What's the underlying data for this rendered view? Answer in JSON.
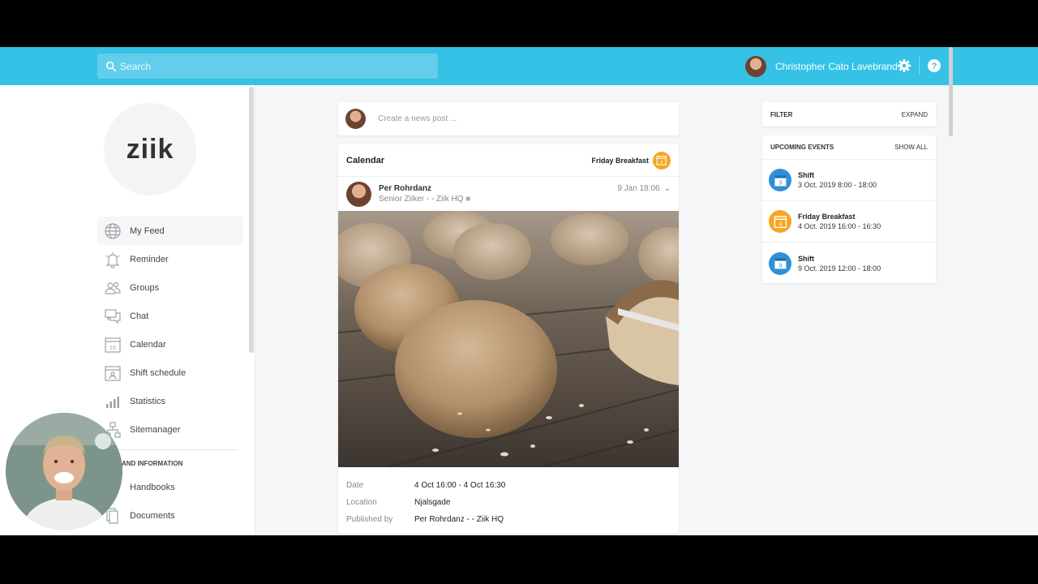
{
  "search": {
    "placeholder": "Search"
  },
  "user": {
    "name": "Christopher Cato Lavebrand"
  },
  "logo": {
    "text": "ziik"
  },
  "sidebar": {
    "items": [
      {
        "label": "My Feed",
        "icon": "globe-icon"
      },
      {
        "label": "Reminder",
        "icon": "bell-icon"
      },
      {
        "label": "Groups",
        "icon": "users-icon"
      },
      {
        "label": "Chat",
        "icon": "chat-icon"
      },
      {
        "label": "Calendar",
        "icon": "calendar-icon"
      },
      {
        "label": "Shift schedule",
        "icon": "shift-icon"
      },
      {
        "label": "Statistics",
        "icon": "bar-chart-icon"
      },
      {
        "label": "Sitemanager",
        "icon": "sitemap-icon"
      }
    ],
    "section_title": "AND INFORMATION",
    "info_items": [
      {
        "label": "Handbooks",
        "icon": "book-icon"
      },
      {
        "label": "Documents",
        "icon": "document-icon"
      }
    ]
  },
  "compose": {
    "placeholder": "Create a news post ..."
  },
  "post": {
    "type": "Calendar",
    "event_name": "Friday Breakfast",
    "event_day": "4",
    "author": "Per Rohrdanz",
    "subtitle": "Senior Ziiker - - Ziik HQ",
    "time": "9 Jan 18:06",
    "details": [
      {
        "key": "Date",
        "value": "4 Oct 16:00 - 4 Oct 16:30"
      },
      {
        "key": "Location",
        "value": "Njalsgade"
      },
      {
        "key": "Published by",
        "value": "Per Rohrdanz - - ",
        "bold": "Ziik HQ"
      }
    ]
  },
  "filter": {
    "label": "FILTER",
    "action": "EXPAND"
  },
  "events": {
    "title": "UPCOMING EVENTS",
    "action": "SHOW ALL",
    "items": [
      {
        "title": "Shift",
        "date": "3 Oct. 2019 8:00 - 18:00",
        "day": "3",
        "color": "#2f8fd8"
      },
      {
        "title": "Friday Breakfast",
        "date": "4 Oct. 2019 16:00 - 16:30",
        "day": "4",
        "color": "#f5a623"
      },
      {
        "title": "Shift",
        "date": "9 Oct. 2019 12:00 - 18:00",
        "day": "9",
        "color": "#2f8fd8"
      }
    ]
  },
  "colors": {
    "topbar": "#36c1e6",
    "shift": "#2f8fd8",
    "event": "#f5a623"
  }
}
